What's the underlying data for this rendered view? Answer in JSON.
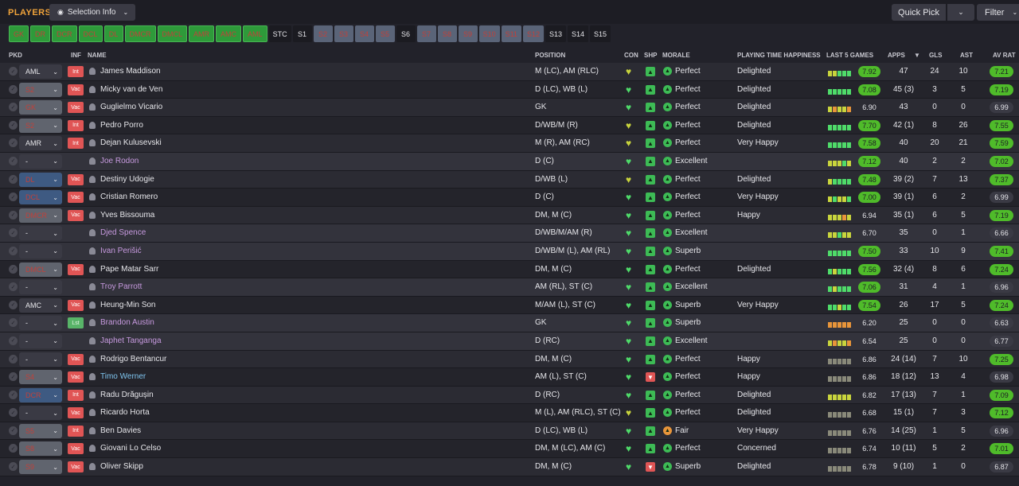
{
  "header": {
    "title": "PLAYERS",
    "selection_info": "Selection Info",
    "quick_pick": "Quick Pick",
    "filter": "Filter"
  },
  "position_filters": [
    {
      "label": "GK",
      "style": "g"
    },
    {
      "label": "DR",
      "style": "g"
    },
    {
      "label": "DCR",
      "style": "g"
    },
    {
      "label": "DCL",
      "style": "g"
    },
    {
      "label": "DL",
      "style": "g"
    },
    {
      "label": "DMCR",
      "style": "g"
    },
    {
      "label": "DMCL",
      "style": "g"
    },
    {
      "label": "AMR",
      "style": "g"
    },
    {
      "label": "AMC",
      "style": "g"
    },
    {
      "label": "AML",
      "style": "g"
    },
    {
      "label": "STC",
      "style": "n"
    },
    {
      "label": "S1",
      "style": "n"
    },
    {
      "label": "S2",
      "style": "s"
    },
    {
      "label": "S3",
      "style": "s"
    },
    {
      "label": "S4",
      "style": "s"
    },
    {
      "label": "S5",
      "style": "s"
    },
    {
      "label": "S6",
      "style": "n"
    },
    {
      "label": "S7",
      "style": "s"
    },
    {
      "label": "S8",
      "style": "s"
    },
    {
      "label": "S9",
      "style": "s"
    },
    {
      "label": "S10",
      "style": "s"
    },
    {
      "label": "S11",
      "style": "s"
    },
    {
      "label": "S12",
      "style": "s"
    },
    {
      "label": "S13",
      "style": "n"
    },
    {
      "label": "S14",
      "style": "n"
    },
    {
      "label": "S15",
      "style": "n"
    }
  ],
  "columns": {
    "pkd": "PKD",
    "inf": "INF",
    "name": "NAME",
    "position": "POSITION",
    "con": "CON",
    "shp": "SHP",
    "morale": "MORALE",
    "pth": "PLAYING TIME HAPPINESS",
    "form": "LAST 5 GAMES",
    "apps": "APPS",
    "gls": "GLS",
    "ast": "AST",
    "avrat": "AV RAT"
  },
  "players": [
    {
      "pkd": "AML",
      "pk_style": "none",
      "inf": "Int",
      "name": "James Maddison",
      "name_style": "",
      "position": "M (LC), AM (RLC)",
      "con": "y",
      "shp": "g",
      "morale_style": "g",
      "morale": "Perfect",
      "pth": "Delighted",
      "form": [
        "fy",
        "fy",
        "fg",
        "fg",
        "fg"
      ],
      "rating": "7.92",
      "rating_style": "g",
      "apps": "47",
      "gls": "24",
      "ast": "10",
      "avrat": "7.21",
      "avrat_style": "g"
    },
    {
      "pkd": "S2",
      "pk_style": "sil",
      "inf": "Vac",
      "name": "Micky van de Ven",
      "name_style": "",
      "position": "D (LC), WB (L)",
      "con": "g",
      "shp": "g",
      "morale_style": "g",
      "morale": "Perfect",
      "pth": "Delighted",
      "form": [
        "fg",
        "fg",
        "fg",
        "fg",
        "fg"
      ],
      "rating": "7.08",
      "rating_style": "g",
      "apps": "45 (3)",
      "gls": "3",
      "ast": "5",
      "avrat": "7.19",
      "avrat_style": "g"
    },
    {
      "pkd": "GK",
      "pk_style": "sil",
      "inf": "Vac",
      "name": "Guglielmo Vicario",
      "name_style": "",
      "position": "GK",
      "con": "g",
      "shp": "g",
      "morale_style": "g",
      "morale": "Perfect",
      "pth": "Delighted",
      "form": [
        "fy",
        "fo",
        "fy",
        "fy",
        "fo"
      ],
      "rating": "6.90",
      "rating_style": "n",
      "apps": "43",
      "gls": "0",
      "ast": "0",
      "avrat": "6.99",
      "avrat_style": "n"
    },
    {
      "pkd": "S2",
      "pk_style": "sil",
      "inf": "Int",
      "name": "Pedro Porro",
      "name_style": "",
      "position": "D/WB/M (R)",
      "con": "y",
      "shp": "g",
      "morale_style": "g",
      "morale": "Perfect",
      "pth": "Delighted",
      "form": [
        "fg",
        "fg",
        "fg",
        "fg",
        "fg"
      ],
      "rating": "7.70",
      "rating_style": "g",
      "apps": "42 (1)",
      "gls": "8",
      "ast": "26",
      "avrat": "7.55",
      "avrat_style": "g"
    },
    {
      "pkd": "AMR",
      "pk_style": "none",
      "inf": "Int",
      "name": "Dejan Kulusevski",
      "name_style": "",
      "position": "M (R), AM (RC)",
      "con": "y",
      "shp": "g",
      "morale_style": "g",
      "morale": "Perfect",
      "pth": "Very Happy",
      "form": [
        "fg",
        "fg",
        "fg",
        "fg",
        "fg"
      ],
      "rating": "7.58",
      "rating_style": "g",
      "apps": "40",
      "gls": "20",
      "ast": "21",
      "avrat": "7.59",
      "avrat_style": "g"
    },
    {
      "pkd": "-",
      "pk_style": "none",
      "inf": "",
      "name": "Joe Rodon",
      "name_style": "loan",
      "position": "D (C)",
      "con": "g",
      "shp": "g",
      "morale_style": "g",
      "morale": "Excellent",
      "pth": "",
      "form": [
        "fy",
        "fy",
        "fy",
        "fg",
        "fy"
      ],
      "rating": "7.12",
      "rating_style": "g",
      "apps": "40",
      "gls": "2",
      "ast": "2",
      "avrat": "7.02",
      "avrat_style": "g"
    },
    {
      "pkd": "DL",
      "pk_style": "blue",
      "inf": "Vac",
      "name": "Destiny Udogie",
      "name_style": "",
      "position": "D/WB (L)",
      "con": "y",
      "shp": "g",
      "morale_style": "g",
      "morale": "Perfect",
      "pth": "Delighted",
      "form": [
        "fy",
        "fg",
        "fg",
        "fg",
        "fg"
      ],
      "rating": "7.48",
      "rating_style": "g",
      "apps": "39 (2)",
      "gls": "7",
      "ast": "13",
      "avrat": "7.37",
      "avrat_style": "g"
    },
    {
      "pkd": "DCL",
      "pk_style": "blue",
      "inf": "Vac",
      "name": "Cristian Romero",
      "name_style": "",
      "position": "D (C)",
      "con": "g",
      "shp": "g",
      "morale_style": "g",
      "morale": "Perfect",
      "pth": "Very Happy",
      "form": [
        "fy",
        "fg",
        "fy",
        "fy",
        "fg"
      ],
      "rating": "7.00",
      "rating_style": "g",
      "apps": "39 (1)",
      "gls": "6",
      "ast": "2",
      "avrat": "6.99",
      "avrat_style": "n"
    },
    {
      "pkd": "DMCR",
      "pk_style": "sil",
      "inf": "Vac",
      "name": "Yves Bissouma",
      "name_style": "",
      "position": "DM, M (C)",
      "con": "g",
      "shp": "g",
      "morale_style": "g",
      "morale": "Perfect",
      "pth": "Happy",
      "form": [
        "fy",
        "fy",
        "fy",
        "fo",
        "fy"
      ],
      "rating": "6.94",
      "rating_style": "n",
      "apps": "35 (1)",
      "gls": "6",
      "ast": "5",
      "avrat": "7.19",
      "avrat_style": "g"
    },
    {
      "pkd": "-",
      "pk_style": "none",
      "inf": "",
      "name": "Djed Spence",
      "name_style": "loan",
      "position": "D/WB/M/AM (R)",
      "con": "g",
      "shp": "g",
      "morale_style": "g",
      "morale": "Excellent",
      "pth": "",
      "form": [
        "fy",
        "fy",
        "fg",
        "fy",
        "fy"
      ],
      "rating": "6.70",
      "rating_style": "n",
      "apps": "35",
      "gls": "0",
      "ast": "1",
      "avrat": "6.66",
      "avrat_style": "n"
    },
    {
      "pkd": "-",
      "pk_style": "none",
      "inf": "",
      "name": "Ivan Perišić",
      "name_style": "loan",
      "position": "D/WB/M (L), AM (RL)",
      "con": "g",
      "shp": "g",
      "morale_style": "g",
      "morale": "Superb",
      "pth": "",
      "form": [
        "fg",
        "fg",
        "fg",
        "fg",
        "fg"
      ],
      "rating": "7.50",
      "rating_style": "g",
      "apps": "33",
      "gls": "10",
      "ast": "9",
      "avrat": "7.41",
      "avrat_style": "g"
    },
    {
      "pkd": "DMCL",
      "pk_style": "sil",
      "inf": "Vac",
      "name": "Pape Matar Sarr",
      "name_style": "",
      "position": "DM, M (C)",
      "con": "g",
      "shp": "g",
      "morale_style": "g",
      "morale": "Perfect",
      "pth": "Delighted",
      "form": [
        "fg",
        "fy",
        "fg",
        "fg",
        "fg"
      ],
      "rating": "7.56",
      "rating_style": "g",
      "apps": "32 (4)",
      "gls": "8",
      "ast": "6",
      "avrat": "7.24",
      "avrat_style": "g"
    },
    {
      "pkd": "-",
      "pk_style": "none",
      "inf": "",
      "name": "Troy Parrott",
      "name_style": "loan",
      "position": "AM (RL), ST (C)",
      "con": "g",
      "shp": "g",
      "morale_style": "g",
      "morale": "Excellent",
      "pth": "",
      "form": [
        "fg",
        "fy",
        "fg",
        "fg",
        "fg"
      ],
      "rating": "7.06",
      "rating_style": "g",
      "apps": "31",
      "gls": "4",
      "ast": "1",
      "avrat": "6.96",
      "avrat_style": "n"
    },
    {
      "pkd": "AMC",
      "pk_style": "none",
      "inf": "Vac",
      "name": "Heung-Min Son",
      "name_style": "",
      "position": "M/AM (L), ST (C)",
      "con": "g",
      "shp": "g",
      "morale_style": "g",
      "morale": "Superb",
      "pth": "Very Happy",
      "form": [
        "fg",
        "fg",
        "fy",
        "fg",
        "fg"
      ],
      "rating": "7.54",
      "rating_style": "g",
      "apps": "26",
      "gls": "17",
      "ast": "5",
      "avrat": "7.24",
      "avrat_style": "g"
    },
    {
      "pkd": "-",
      "pk_style": "none",
      "inf": "Lst",
      "name": "Brandon Austin",
      "name_style": "loan",
      "position": "GK",
      "con": "g",
      "shp": "g",
      "morale_style": "g",
      "morale": "Superb",
      "pth": "",
      "form": [
        "fo",
        "fo",
        "fo",
        "fo",
        "fo"
      ],
      "rating": "6.20",
      "rating_style": "n",
      "apps": "25",
      "gls": "0",
      "ast": "0",
      "avrat": "6.63",
      "avrat_style": "n"
    },
    {
      "pkd": "-",
      "pk_style": "none",
      "inf": "",
      "name": "Japhet Tanganga",
      "name_style": "loan",
      "position": "D (RC)",
      "con": "g",
      "shp": "g",
      "morale_style": "g",
      "morale": "Excellent",
      "pth": "",
      "form": [
        "fy",
        "fo",
        "fy",
        "fy",
        "fo"
      ],
      "rating": "6.54",
      "rating_style": "n",
      "apps": "25",
      "gls": "0",
      "ast": "0",
      "avrat": "6.77",
      "avrat_style": "n"
    },
    {
      "pkd": "-",
      "pk_style": "none",
      "inf": "Vac",
      "name": "Rodrigo Bentancur",
      "name_style": "",
      "position": "DM, M (C)",
      "con": "g",
      "shp": "g",
      "morale_style": "g",
      "morale": "Perfect",
      "pth": "Happy",
      "form": [
        "fgr",
        "fgr",
        "fgr",
        "fgr",
        "fgr"
      ],
      "rating": "6.86",
      "rating_style": "n",
      "apps": "24 (14)",
      "gls": "7",
      "ast": "10",
      "avrat": "7.25",
      "avrat_style": "g"
    },
    {
      "pkd": "S4",
      "pk_style": "sil",
      "inf": "Vac",
      "name": "Timo Werner",
      "name_style": "blue",
      "position": "AM (L), ST (C)",
      "con": "g",
      "shp": "r",
      "morale_style": "g",
      "morale": "Perfect",
      "pth": "Happy",
      "form": [
        "fgr",
        "fgr",
        "fgr",
        "fgr",
        "fgr"
      ],
      "rating": "6.86",
      "rating_style": "n",
      "apps": "18 (12)",
      "gls": "13",
      "ast": "4",
      "avrat": "6.98",
      "avrat_style": "n"
    },
    {
      "pkd": "DCR",
      "pk_style": "blue",
      "inf": "Int",
      "name": "Radu Drăgușin",
      "name_style": "",
      "position": "D (RC)",
      "con": "g",
      "shp": "g",
      "morale_style": "g",
      "morale": "Perfect",
      "pth": "Delighted",
      "form": [
        "fy",
        "fy",
        "fy",
        "fy",
        "fy"
      ],
      "rating": "6.82",
      "rating_style": "n",
      "apps": "17 (13)",
      "gls": "7",
      "ast": "1",
      "avrat": "7.09",
      "avrat_style": "g"
    },
    {
      "pkd": "-",
      "pk_style": "none",
      "inf": "Vac",
      "name": "Ricardo Horta",
      "name_style": "",
      "position": "M (L), AM (RLC), ST (C)",
      "con": "y",
      "shp": "g",
      "morale_style": "g",
      "morale": "Perfect",
      "pth": "Delighted",
      "form": [
        "fgr",
        "fgr",
        "fgr",
        "fgr",
        "fgr"
      ],
      "rating": "6.68",
      "rating_style": "n",
      "apps": "15 (1)",
      "gls": "7",
      "ast": "3",
      "avrat": "7.12",
      "avrat_style": "g"
    },
    {
      "pkd": "S5",
      "pk_style": "sil",
      "inf": "Int",
      "name": "Ben Davies",
      "name_style": "",
      "position": "D (LC), WB (L)",
      "con": "g",
      "shp": "g",
      "morale_style": "o",
      "morale": "Fair",
      "pth": "Very Happy",
      "form": [
        "fgr",
        "fgr",
        "fgr",
        "fgr",
        "fgr"
      ],
      "rating": "6.76",
      "rating_style": "n",
      "apps": "14 (25)",
      "gls": "1",
      "ast": "5",
      "avrat": "6.96",
      "avrat_style": "n"
    },
    {
      "pkd": "S8",
      "pk_style": "sil",
      "inf": "Vac",
      "name": "Giovani Lo Celso",
      "name_style": "",
      "position": "DM, M (LC), AM (C)",
      "con": "g",
      "shp": "g",
      "morale_style": "g",
      "morale": "Perfect",
      "pth": "Concerned",
      "form": [
        "fgr",
        "fgr",
        "fgr",
        "fgr",
        "fgr"
      ],
      "rating": "6.74",
      "rating_style": "n",
      "apps": "10 (11)",
      "gls": "5",
      "ast": "2",
      "avrat": "7.01",
      "avrat_style": "g"
    },
    {
      "pkd": "S9",
      "pk_style": "sil",
      "inf": "Vac",
      "name": "Oliver Skipp",
      "name_style": "",
      "position": "DM, M (C)",
      "con": "g",
      "shp": "r",
      "morale_style": "g",
      "morale": "Superb",
      "pth": "Delighted",
      "form": [
        "fgr",
        "fgr",
        "fgr",
        "fgr",
        "fgr"
      ],
      "rating": "6.78",
      "rating_style": "n",
      "apps": "9 (10)",
      "gls": "1",
      "ast": "0",
      "avrat": "6.87",
      "avrat_style": "n"
    }
  ]
}
